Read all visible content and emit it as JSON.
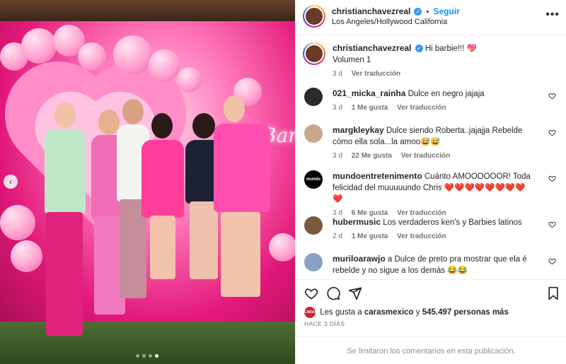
{
  "post": {
    "username": "christianchavezreal",
    "follow_label": "Seguir",
    "location": "Los Angeles/Hollywood California",
    "more_icon": "more-icon"
  },
  "caption": {
    "username": "christianchavezreal",
    "text": "Hi barbie!!! 💖",
    "line2": "Volumen 1",
    "time": "3 d",
    "translate": "Ver traducción"
  },
  "comments": [
    {
      "username": "021_micka_rainha",
      "text": "Dulce en negro jajaja",
      "time": "3 d",
      "likes": "1 Me gusta",
      "translate": "Ver traducción"
    },
    {
      "username": "margkleykay",
      "text": "Dulce siendo Roberta..jajajja Rebelde cómo ella sola...la amoo😅😅",
      "time": "3 d",
      "likes": "22 Me gusta",
      "translate": "Ver traducción"
    },
    {
      "username": "mundoentretenimento",
      "text": "Cuánto AMOOOOOOR! Toda felicidad del muuuuundo Chris ❤️❤️❤️❤️❤️❤️❤️❤️❤️",
      "time": "3 d",
      "likes": "6 Me gusta",
      "translate": "Ver traducción"
    },
    {
      "username": "hubermusic",
      "text": "Los verdaderos ken's y Barbies latinos",
      "time": "2 d",
      "likes": "1 Me gusta",
      "translate": "Ver traducción"
    },
    {
      "username": "muriloarawjo",
      "text": "a Dulce de preto pra mostrar que ela é rebelde y no sigue a los demás 😂😂",
      "time": "",
      "likes": "",
      "translate": ""
    }
  ],
  "mundo_avatar_text": "mundo",
  "likes": {
    "prefix": "Les gusta a",
    "user": "carasmexico",
    "conj": "y",
    "count": "545.497 personas más",
    "avatar_text": "CARAS"
  },
  "time_ago": "HACE 3 DÍAS",
  "closed_text": "Se limitaron los comentarios en esta publicación.",
  "photo": {
    "sign_text": "Barbie",
    "carousel_icon": "chevron-left-icon",
    "carousel_glyph": "‹",
    "page_index": 4,
    "page_count": 4
  },
  "colors": {
    "accent": "#0095f6",
    "verified": "#3897f0",
    "heart": "#ed4956"
  }
}
